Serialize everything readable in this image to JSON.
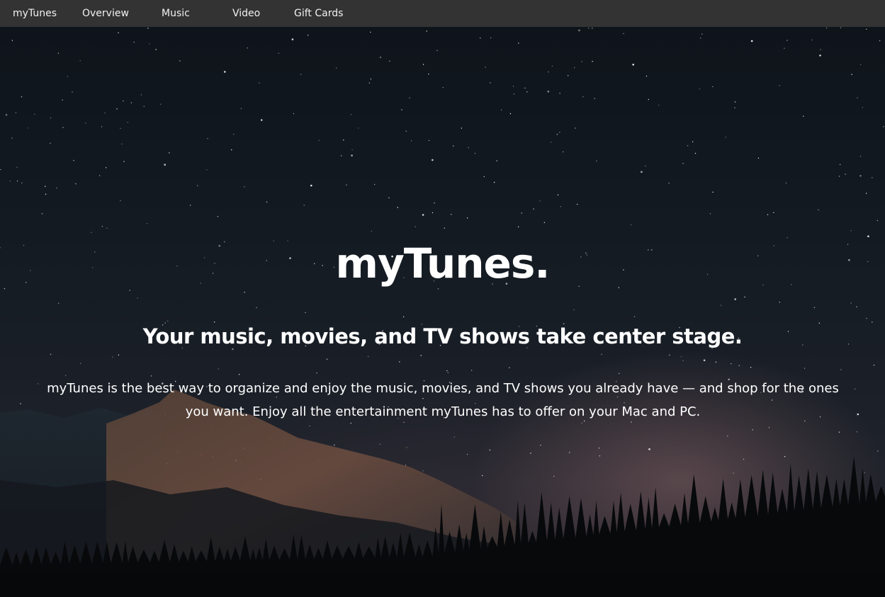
{
  "nav": {
    "brand": "myTunes",
    "items": [
      "Overview",
      "Music",
      "Video",
      "Gift Cards"
    ]
  },
  "hero": {
    "title": "myTunes.",
    "subtitle": "Your music, movies, and TV shows take center stage.",
    "description": "myTunes is the best way to organize and enjoy the music, movies, and TV shows you already have — and shop for the ones you want. Enjoy all the entertainment myTunes has to offer on your Mac and PC.",
    "background": "night-sky-mountains-photo"
  },
  "colors": {
    "nav_background": "#333333",
    "nav_text": "#f2f2f2",
    "hero_text": "#ffffff"
  }
}
